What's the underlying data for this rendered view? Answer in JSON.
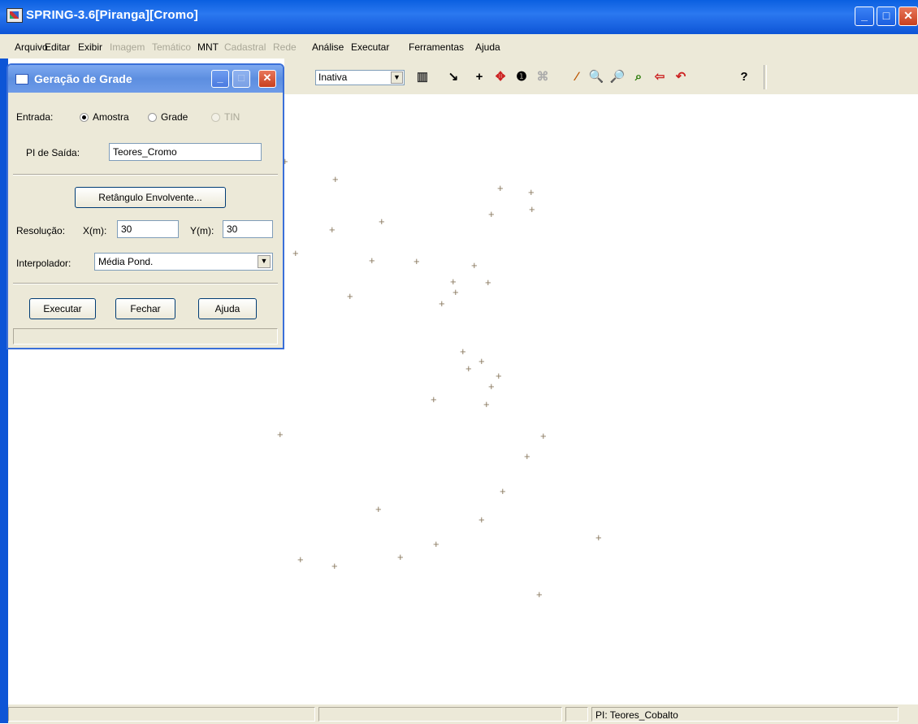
{
  "window": {
    "title": "SPRING-3.6[Piranga][Cromo]"
  },
  "menu": {
    "items": [
      {
        "label": "Arquivo",
        "enabled": true
      },
      {
        "label": "Editar",
        "enabled": true
      },
      {
        "label": "Exibir",
        "enabled": true
      },
      {
        "label": "Imagem",
        "enabled": false
      },
      {
        "label": "Temático",
        "enabled": false
      },
      {
        "label": "MNT",
        "enabled": true
      },
      {
        "label": "Cadastral",
        "enabled": false
      },
      {
        "label": "Rede",
        "enabled": false
      },
      {
        "label": "Análise",
        "enabled": true
      },
      {
        "label": "Executar",
        "enabled": true
      },
      {
        "label": "Ferramentas",
        "enabled": true
      },
      {
        "label": "Ajuda",
        "enabled": true
      }
    ]
  },
  "toolbar": {
    "mode_value": "Inativa",
    "tools": [
      "layers-icon",
      "arrow-down-right-icon",
      "crosshair-icon",
      "pan-icon",
      "info-icon",
      "tag-icon",
      "draw-line-icon",
      "zoom-in-icon",
      "zoom-out-icon",
      "zoom-area-icon",
      "back-icon",
      "undo-icon",
      "help-icon"
    ]
  },
  "dialog": {
    "title": "Geração de Grade",
    "entrada_label": "Entrada:",
    "entrada_options": [
      {
        "label": "Amostra",
        "selected": true,
        "enabled": true
      },
      {
        "label": "Grade",
        "selected": false,
        "enabled": true
      },
      {
        "label": "TIN",
        "selected": false,
        "enabled": false
      }
    ],
    "pl_saida_label": "PI de Saída:",
    "pl_saida_value": "Teores_Cromo",
    "retangulo_button": "Retângulo Envolvente...",
    "resolucao_label": "Resolução:",
    "x_label": "X(m):",
    "x_value": "30",
    "y_label": "Y(m):",
    "y_value": "30",
    "interpolador_label": "Interpolador:",
    "interpolador_value": "Média Pond.",
    "executar_button": "Executar",
    "fechar_button": "Fechar",
    "ajuda_button": "Ajuda"
  },
  "status": {
    "pi_text": "PI: Teores_Cobalto"
  },
  "colors": {
    "titlebar": "#0a5fe0",
    "face": "#ece9d8",
    "sample_point": "#8a7a60"
  }
}
